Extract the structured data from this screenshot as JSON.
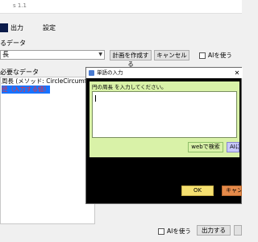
{
  "window": {
    "title": "s 1.1"
  },
  "tabs": [
    {
      "label": ""
    },
    {
      "label": "出力"
    },
    {
      "label": "設定"
    }
  ],
  "data_section": {
    "label": "るデータ",
    "combo_value": "長",
    "plan_button": "計画を作成する",
    "cancel_button": "キャンセル",
    "ai_checkbox": "AIを使う"
  },
  "needed_section": {
    "label": "必要なデータ",
    "rows": [
      "周長 (メソッド: CircleCircumferen",
      "径（入力する値）"
    ]
  },
  "dialog": {
    "title": "単語の入力",
    "prompt": "円の周長 を入力してください。",
    "input_value": "",
    "web_search_button": "webで検索",
    "ai_button": "AIに任",
    "ok_button": "OK",
    "cancel_button": "キャン"
  },
  "footer": {
    "ai_checkbox": "AIを使う",
    "output_button": "出力する"
  }
}
